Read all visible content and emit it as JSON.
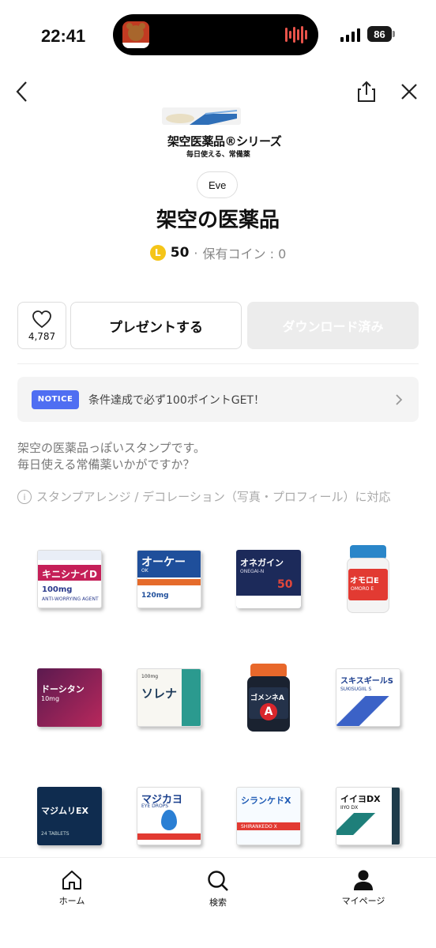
{
  "status_bar": {
    "time": "22:41",
    "battery": "86"
  },
  "banner": {
    "title": "架空医薬品®シリーズ",
    "subtitle": "毎日使える、常備薬"
  },
  "product": {
    "author": "Eve",
    "title": "架空の医薬品",
    "price_badge": "L",
    "price": "50",
    "separator": "·",
    "owned_coins": "保有コイン : 0"
  },
  "actions": {
    "like_count": "4,787",
    "present_label": "プレゼントする",
    "download_label": "ダウンロード済み"
  },
  "notice": {
    "tag": "NOTICE",
    "text": "条件達成で必ず100ポイントGET！"
  },
  "description": {
    "line1": "架空の医薬品っぽいスタンプです。",
    "line2": "毎日使える常備薬いかがですか？"
  },
  "feature_note": "スタンプアレンジ / デコレーション（写真・プロフィール）に対応",
  "stickers": [
    {
      "name": "キニシナイD",
      "dose": "100mg",
      "sub": "ANTI-WORRYING AGENT"
    },
    {
      "name": "オーケー",
      "sub": "OK",
      "dose": "120mg"
    },
    {
      "name": "オネガイン",
      "sub": "ONEGAI-N",
      "dose": "50"
    },
    {
      "name": "オモロE",
      "sub": "OMORO E"
    },
    {
      "name": "ドーシタン",
      "dose": "10mg"
    },
    {
      "name": "ソレナ",
      "dose": "100mg"
    },
    {
      "name": "ゴメンネA",
      "sub": "A"
    },
    {
      "name": "スキスギールS",
      "sub": "SUKISUGIIL S"
    },
    {
      "name": "マジムリEX",
      "sub": "24 TABLETS"
    },
    {
      "name": "マジカヨ",
      "sub": "EYE DROPS"
    },
    {
      "name": "シランケドX",
      "sub": "SHIRANKEDO X"
    },
    {
      "name": "イイヨDX",
      "sub": "IIYO DX"
    }
  ],
  "tabs": {
    "home": "ホーム",
    "search": "検索",
    "mypage": "マイページ"
  },
  "colors": {
    "notice_tag": "#4f6ef2",
    "coin": "#f5c518",
    "download_disabled": "#ececec"
  }
}
